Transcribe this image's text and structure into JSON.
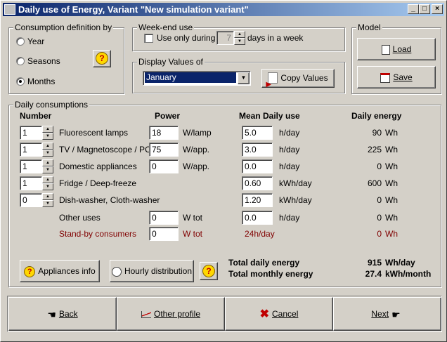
{
  "window": {
    "title": "Daily use of Energy, Variant  \"New simulation variant\"",
    "minimize": "_",
    "maximize": "□",
    "close": "×"
  },
  "consumption_definition": {
    "label": "Consumption definition by",
    "options": [
      "Year",
      "Seasons",
      "Months"
    ],
    "selected": "Months",
    "help": "?"
  },
  "weekend": {
    "label": "Week-end use",
    "checkbox_label": "Use only during",
    "checked": false,
    "days": "7",
    "suffix": "days in a week"
  },
  "display_values": {
    "label": "Display Values of",
    "selected": "January",
    "copy_button": "Copy Values"
  },
  "model": {
    "label": "Model",
    "load": "Load",
    "save": "Save"
  },
  "daily": {
    "label": "Daily consumptions",
    "headers": {
      "number": "Number",
      "power": "Power",
      "mean": "Mean Daily use",
      "energy": "Daily energy"
    },
    "rows": [
      {
        "number": "1",
        "name": "Fluorescent lamps",
        "power": "18",
        "power_unit": "W/lamp",
        "use": "5.0",
        "use_unit": "h/day",
        "energy": "90",
        "energy_unit": "Wh"
      },
      {
        "number": "1",
        "name": "TV / Magnetoscope / PC",
        "power": "75",
        "power_unit": "W/app.",
        "use": "3.0",
        "use_unit": "h/day",
        "energy": "225",
        "energy_unit": "Wh"
      },
      {
        "number": "1",
        "name": "Domestic appliances",
        "power": "0",
        "power_unit": "W/app.",
        "use": "0.0",
        "use_unit": "h/day",
        "energy": "0",
        "energy_unit": "Wh"
      },
      {
        "number": "1",
        "name": "Fridge / Deep-freeze",
        "power": "",
        "power_unit": "",
        "use": "0.60",
        "use_unit": "kWh/day",
        "energy": "600",
        "energy_unit": "Wh"
      },
      {
        "number": "0",
        "name": "Dish-washer,  Cloth-washer",
        "power": "",
        "power_unit": "",
        "use": "1.20",
        "use_unit": "kWh/day",
        "energy": "0",
        "energy_unit": "Wh"
      }
    ],
    "other": {
      "name": "Other uses",
      "power": "0",
      "power_unit": "W tot",
      "use": "0.0",
      "use_unit": "h/day",
      "energy": "0",
      "energy_unit": "Wh"
    },
    "standby": {
      "name": "Stand-by consumers",
      "power": "0",
      "power_unit": "W tot",
      "use_text": "24h/day",
      "energy": "0",
      "energy_unit": "Wh"
    },
    "appliances_info": "Appliances info",
    "hourly": "Hourly distribution",
    "total_daily_label": "Total daily energy",
    "total_daily_value": "915",
    "total_daily_unit": "Wh/day",
    "total_monthly_label": "Total monthly energy",
    "total_monthly_value": "27.4",
    "total_monthly_unit": "kWh/month"
  },
  "nav": {
    "back": "Back",
    "other": "Other profile",
    "cancel": "Cancel",
    "next": "Next"
  },
  "colors": {
    "title_start": "#0a246a",
    "title_end": "#a6caf0",
    "standby": "#800000"
  }
}
